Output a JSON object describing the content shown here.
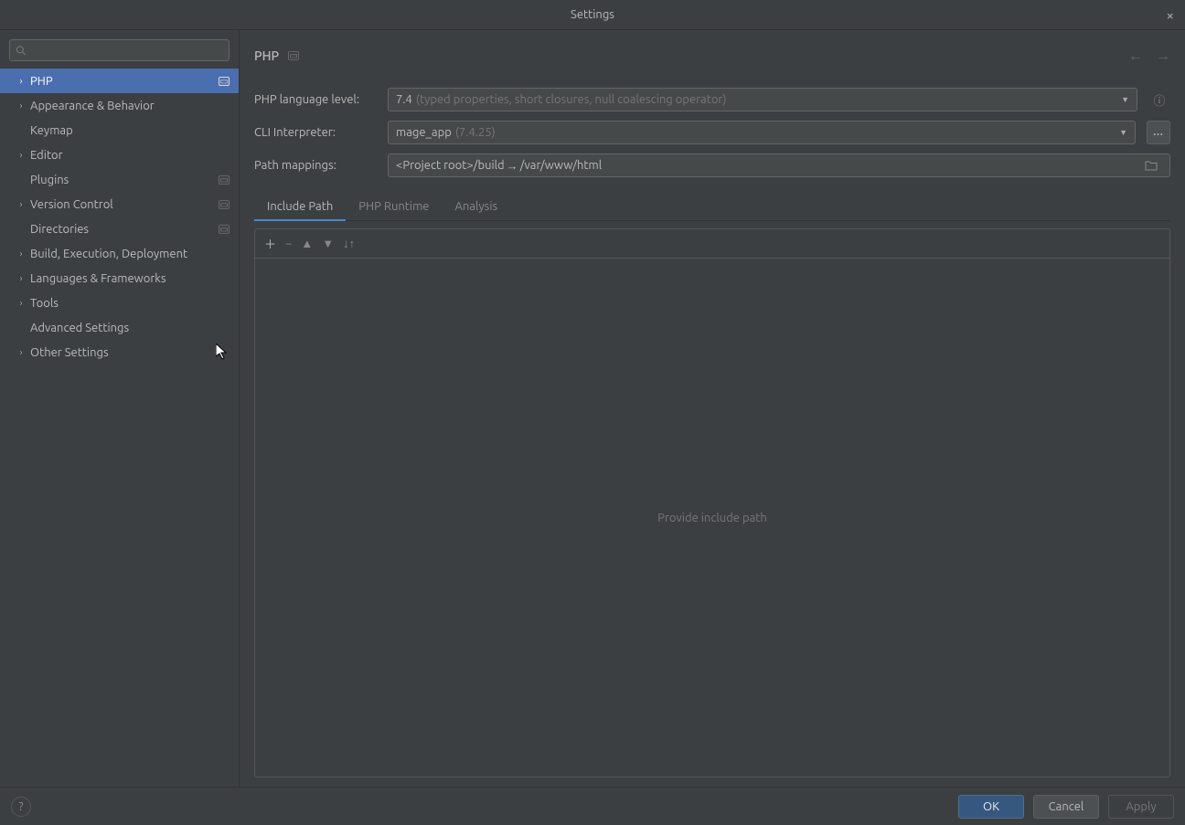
{
  "window": {
    "title": "Settings"
  },
  "search": {
    "placeholder": ""
  },
  "sidebar": {
    "items": [
      {
        "label": "PHP",
        "expandable": true,
        "selected": true,
        "badge": true
      },
      {
        "label": "Appearance & Behavior",
        "expandable": true
      },
      {
        "label": "Keymap",
        "expandable": false
      },
      {
        "label": "Editor",
        "expandable": true
      },
      {
        "label": "Plugins",
        "expandable": false,
        "badge": true
      },
      {
        "label": "Version Control",
        "expandable": true,
        "badge": true
      },
      {
        "label": "Directories",
        "expandable": false,
        "badge": true
      },
      {
        "label": "Build, Execution, Deployment",
        "expandable": true
      },
      {
        "label": "Languages & Frameworks",
        "expandable": true
      },
      {
        "label": "Tools",
        "expandable": true
      },
      {
        "label": "Advanced Settings",
        "expandable": false
      },
      {
        "label": "Other Settings",
        "expandable": true
      }
    ]
  },
  "breadcrumb": {
    "title": "PHP"
  },
  "form": {
    "lang_level_label": "PHP language level:",
    "lang_level_value": "7.4",
    "lang_level_hint": "(typed properties, short closures, null coalescing operator)",
    "cli_label": "CLI Interpreter:",
    "cli_value": "mage_app",
    "cli_hint": "(7.4.25)",
    "path_label": "Path mappings:",
    "path_prefix": "<Project root>/build",
    "path_target": "/var/www/html"
  },
  "tabs": [
    {
      "label": "Include Path",
      "active": true
    },
    {
      "label": "PHP Runtime",
      "active": false
    },
    {
      "label": "Analysis",
      "active": false
    }
  ],
  "list": {
    "empty_text": "Provide include path"
  },
  "footer": {
    "ok": "OK",
    "cancel": "Cancel",
    "apply": "Apply"
  }
}
